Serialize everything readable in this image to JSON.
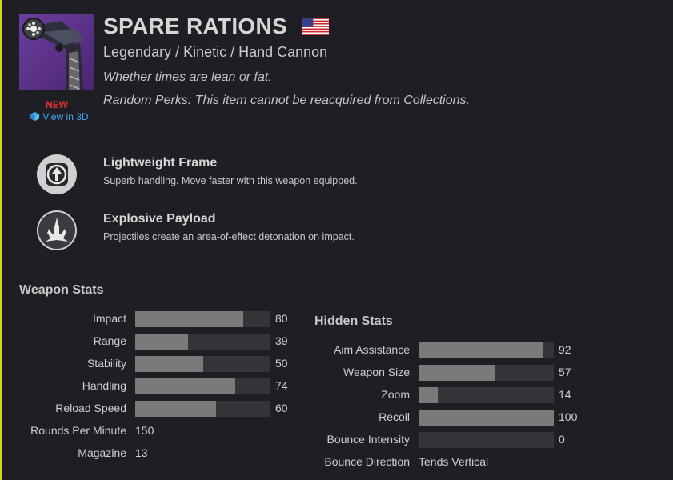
{
  "item": {
    "name": "SPARE RATIONS",
    "subtitle": "Legendary / Kinetic / Hand Cannon",
    "flavor": "Whether times are lean or fat.",
    "random_perks_note": "Random Perks: This item cannot be reacquired from Collections.",
    "new_label": "NEW",
    "view_3d_label": "View in 3D",
    "flag_icon": "us-flag-icon",
    "icon_bg_color": "#5a2f8a"
  },
  "perks": [
    {
      "name": "Lightweight Frame",
      "description": "Superb handling. Move faster with this weapon equipped.",
      "icon": "lightweight-frame-icon"
    },
    {
      "name": "Explosive Payload",
      "description": "Projectiles create an area-of-effect detonation on impact.",
      "icon": "explosive-payload-icon"
    }
  ],
  "weapon_stats": {
    "title": "Weapon Stats",
    "bars": [
      {
        "label": "Impact",
        "value": 80
      },
      {
        "label": "Range",
        "value": 39
      },
      {
        "label": "Stability",
        "value": 50
      },
      {
        "label": "Handling",
        "value": 74
      },
      {
        "label": "Reload Speed",
        "value": 60
      }
    ],
    "plain": [
      {
        "label": "Rounds Per Minute",
        "value": "150"
      },
      {
        "label": "Magazine",
        "value": "13"
      }
    ]
  },
  "hidden_stats": {
    "title": "Hidden Stats",
    "bars": [
      {
        "label": "Aim Assistance",
        "value": 92
      },
      {
        "label": "Weapon Size",
        "value": 57
      },
      {
        "label": "Zoom",
        "value": 14
      },
      {
        "label": "Recoil",
        "value": 100
      },
      {
        "label": "Bounce Intensity",
        "value": 0
      }
    ],
    "plain": [
      {
        "label": "Bounce Direction",
        "value": "Tends Vertical"
      }
    ]
  },
  "colors": {
    "accent": "#d4d91a",
    "new": "#e2332e",
    "link": "#3ea6e8",
    "bar_fill": "#7a7a7a",
    "bar_track": "#353438"
  }
}
